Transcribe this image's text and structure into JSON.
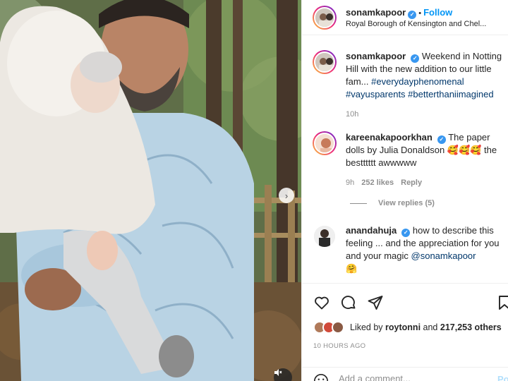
{
  "post": {
    "author": "sonamkapoor",
    "follow_label": "Follow",
    "separator": "•",
    "location": "Royal Borough of Kensington and Chel..."
  },
  "caption": {
    "username": "sonamkapoor",
    "text": "Weekend in Notting Hill with the new addition to our little fam...",
    "hashtags": "#everydayphenomenal #vayusparents #betterthaniimagined",
    "time": "10h"
  },
  "comments": [
    {
      "username": "kareenakapoorkhan",
      "text": "The paper dolls by Julia Donaldson 🥰🥰🥰 the bestttttt awwwww",
      "time": "9h",
      "likes": "252 likes",
      "reply_label": "Reply"
    },
    {
      "username": "anandahuja",
      "text": "how to describe this feeling ... and the appreciation for you and your magic",
      "mention": "@sonamkapoor",
      "emoji": "🤗"
    }
  ],
  "view_replies": "View replies (5)",
  "actions": {
    "icons": [
      "heart-icon",
      "comment-icon",
      "share-icon",
      "bookmark-icon"
    ]
  },
  "likes": {
    "prefix": "Liked by",
    "user": "roytonni",
    "and": "and",
    "others": "217,253 others"
  },
  "time_ago": "10 HOURS AGO",
  "add_comment": {
    "placeholder": "Add a comment...",
    "post_label": "Post"
  },
  "colors": {
    "accent": "#0095f6",
    "verified": "#3897f0",
    "muted": "#8e8e8e"
  }
}
